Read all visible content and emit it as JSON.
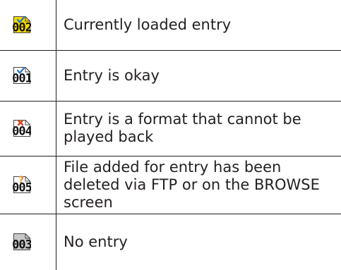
{
  "legend": {
    "rows": [
      {
        "icon_name": "current-entry-icon",
        "badge": "check",
        "number": "002",
        "description": "Currently loaded entry",
        "background": "#f5d800",
        "mark_color": "#2a78c8"
      },
      {
        "icon_name": "entry-ok-icon",
        "badge": "check",
        "number": "001",
        "description": "Entry is okay",
        "background": "#ffffff",
        "mark_color": "#2a78c8"
      },
      {
        "icon_name": "entry-error-icon",
        "badge": "x",
        "number": "004",
        "description": "Entry is a format that cannot be played back",
        "background": "#ffffff",
        "mark_color": "#d8421e"
      },
      {
        "icon_name": "file-deleted-icon",
        "badge": "?",
        "number": "005",
        "description": "File added for entry has been deleted via FTP or on the BROWSE screen",
        "background": "#ffffff",
        "mark_color": "#e98a2a"
      },
      {
        "icon_name": "no-entry-icon",
        "badge": "",
        "number": "003",
        "description": "No entry",
        "background": "#c8c8c8",
        "mark_color": "#888888"
      }
    ]
  }
}
